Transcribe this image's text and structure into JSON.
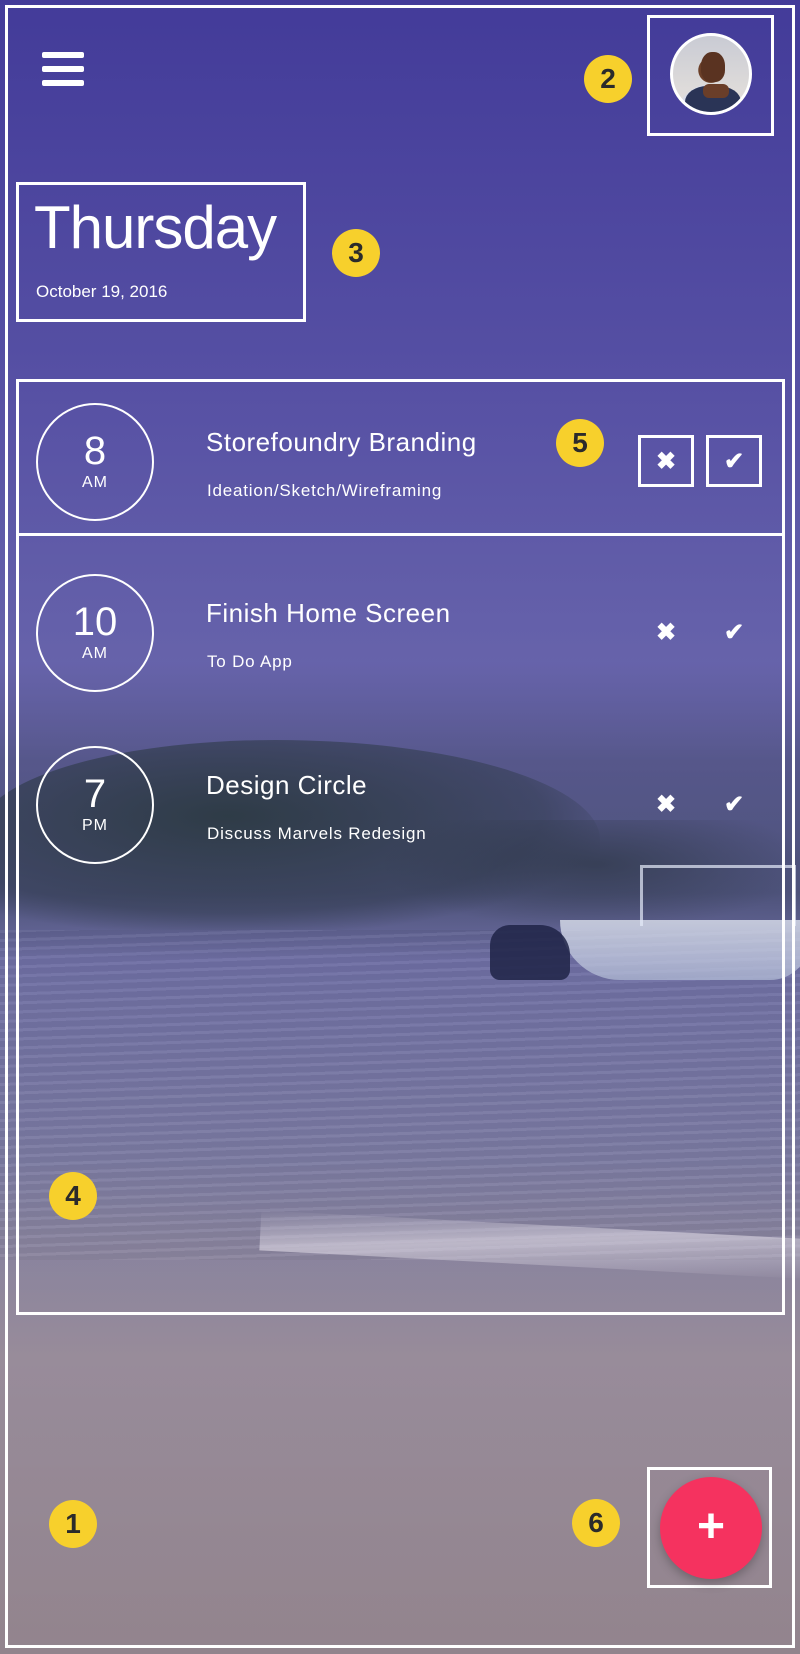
{
  "header": {
    "menu_icon": "hamburger-menu-icon",
    "avatar_icon": "user-avatar"
  },
  "date_block": {
    "day": "Thursday",
    "date": "October 19, 2016"
  },
  "tasks": [
    {
      "hour": "8",
      "ampm": "AM",
      "title": "Storefoundry Branding",
      "subtitle": "Ideation/Sketch/Wireframing",
      "dismiss": "✖",
      "complete": "✔"
    },
    {
      "hour": "10",
      "ampm": "AM",
      "title": "Finish Home Screen",
      "subtitle": "To Do App",
      "dismiss": "✖",
      "complete": "✔"
    },
    {
      "hour": "7",
      "ampm": "PM",
      "title": "Design Circle",
      "subtitle": "Discuss Marvels Redesign",
      "dismiss": "✖",
      "complete": "✔"
    }
  ],
  "fab": {
    "label": "+"
  },
  "annotations": {
    "badge_1": "1",
    "badge_2": "2",
    "badge_3": "3",
    "badge_4": "4",
    "badge_5": "5",
    "badge_6": "6"
  },
  "colors": {
    "overlay": "#3e3496",
    "fab": "#f5325f",
    "badge": "#f7d02c",
    "outline": "#ffffff"
  }
}
